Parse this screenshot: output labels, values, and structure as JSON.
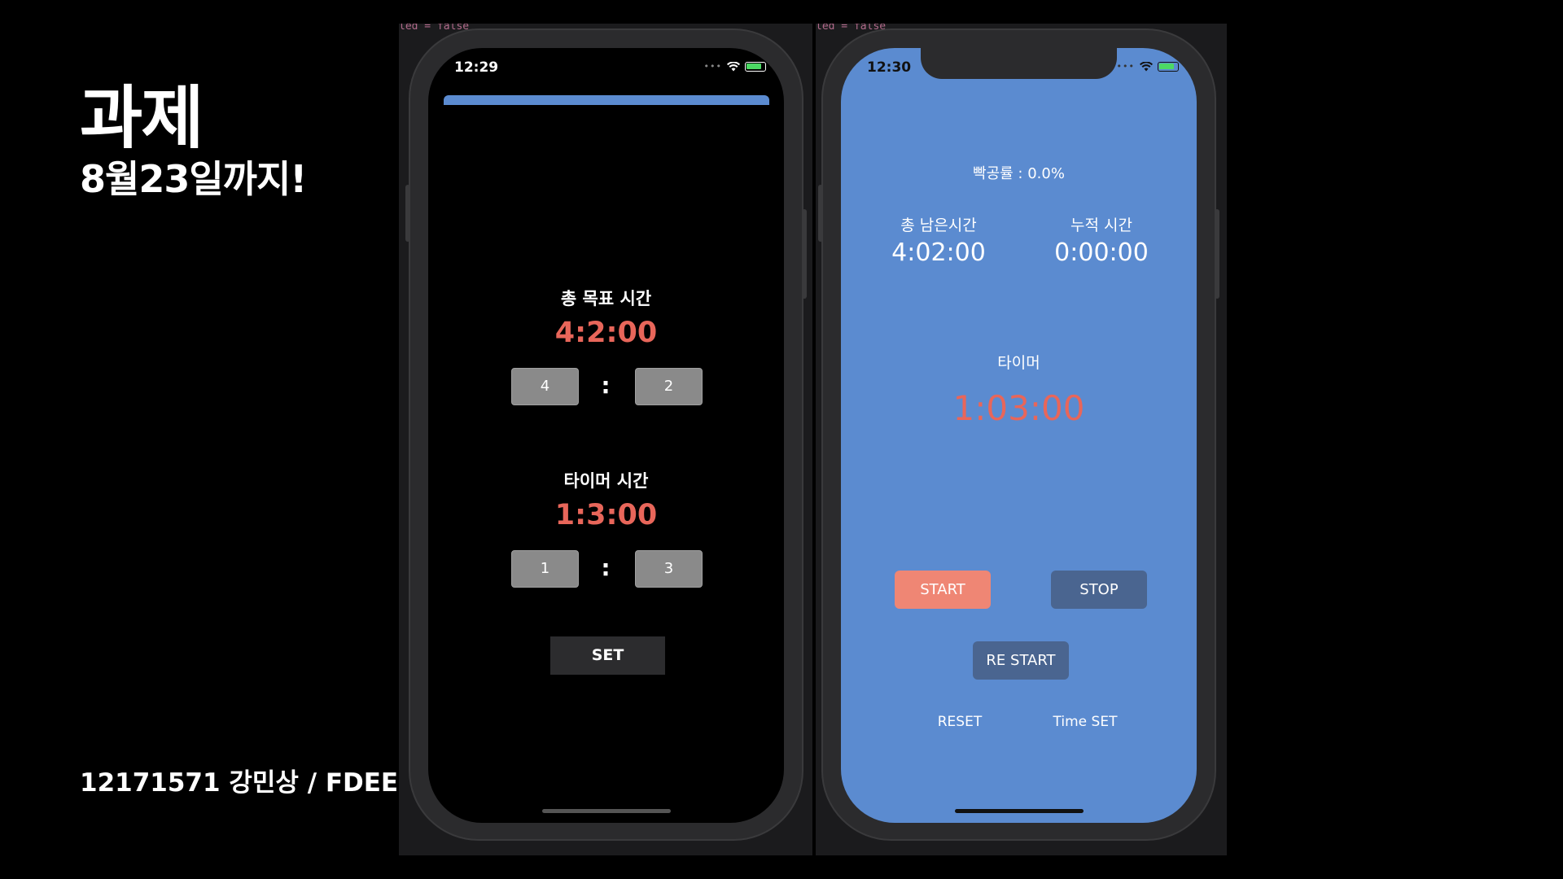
{
  "slide": {
    "title": "과제",
    "subtitle": "8월23일까지!",
    "footer": "12171571 강민상 / FDEE"
  },
  "code_fragment": "led = false",
  "left_phone": {
    "status_time": "12:29",
    "goal_label": "총 목표 시간",
    "goal_time": "4:2:00",
    "goal_hours": "4",
    "goal_minutes": "2",
    "colon": ":",
    "timer_label": "타이머 시간",
    "timer_time": "1:3:00",
    "timer_hours": "1",
    "timer_minutes": "3",
    "set_label": "SET"
  },
  "right_phone": {
    "status_time": "12:30",
    "rate": "빡공률 : 0.0%",
    "remaining_label": "총 남은시간",
    "remaining_value": "4:02:00",
    "accumulated_label": "누적 시간",
    "accumulated_value": "0:00:00",
    "timer_label": "타이머",
    "timer_value": "1:03:00",
    "start_label": "START",
    "stop_label": "STOP",
    "restart_label": "RE START",
    "reset_label": "RESET",
    "timeset_label": "Time SET"
  },
  "colors": {
    "accent_red": "#e8665a",
    "screen_blue": "#5b8bd0",
    "start_button": "#ef8674",
    "dark_button": "#4a6590"
  },
  "icons": [
    "wifi-icon",
    "battery-icon"
  ]
}
